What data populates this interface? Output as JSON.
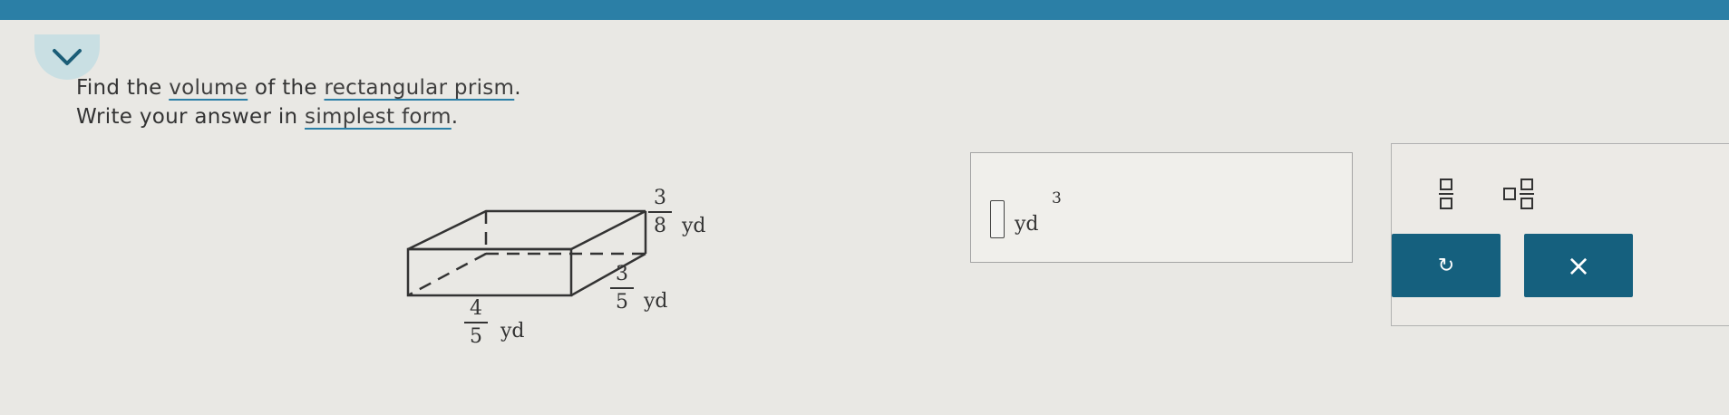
{
  "question": {
    "line1": {
      "pre": "Find the ",
      "term1": "volume",
      "mid": " of the ",
      "term2": "rectangular prism",
      "post": "."
    },
    "line2": {
      "pre": "Write your answer in ",
      "term": "simplest form",
      "post": "."
    }
  },
  "figure": {
    "top_dim": {
      "numerator": "3",
      "denominator": "8",
      "unit": "yd"
    },
    "right_dim": {
      "numerator": "3",
      "denominator": "5",
      "unit": "yd"
    },
    "bottom_dim": {
      "numerator": "4",
      "denominator": "5",
      "unit": "yd"
    }
  },
  "answer": {
    "value": "",
    "unit": "yd",
    "exponent": "3"
  },
  "keypad": {
    "reset_symbol": "↻",
    "clear_symbol": "×"
  },
  "colors": {
    "top_bar": "#2b7fa6",
    "chevron_bg": "#c9dfe3",
    "action_button": "#15607e",
    "background": "#e9e8e4"
  }
}
